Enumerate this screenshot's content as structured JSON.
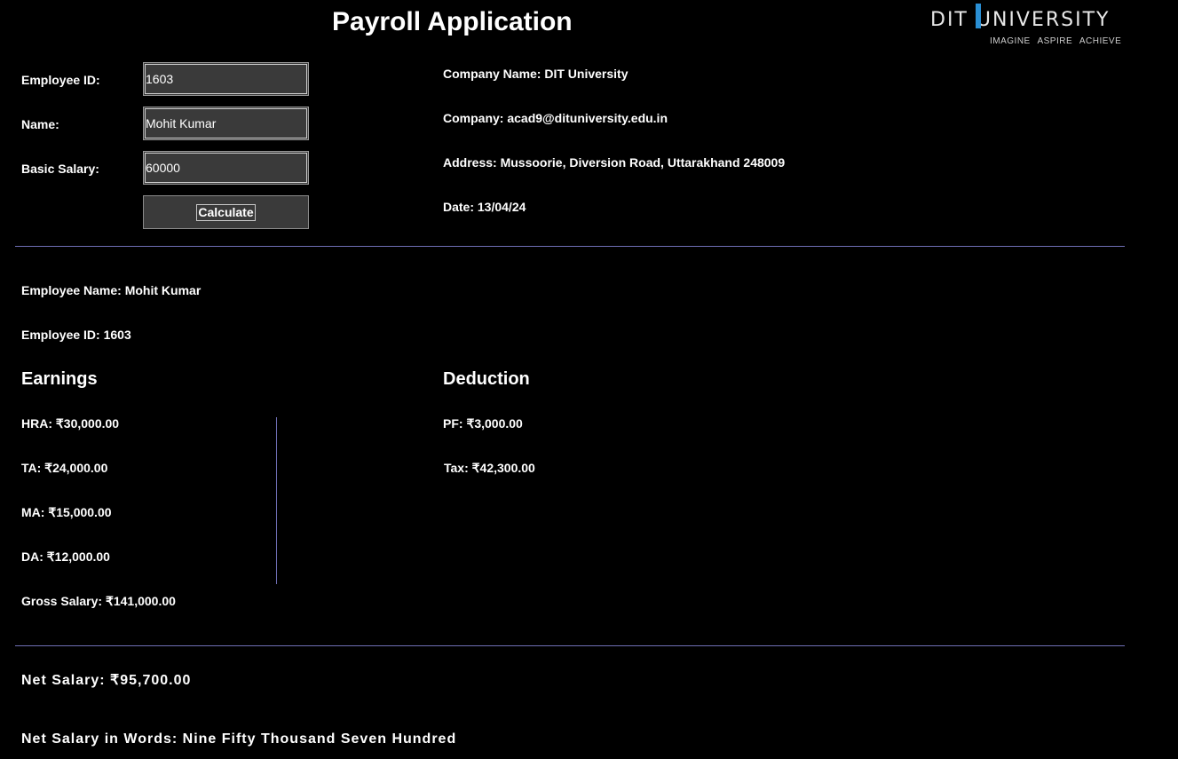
{
  "app": {
    "title": "Payroll Application"
  },
  "logo": {
    "name": "DIT UNIVERSITY",
    "tagline": "IMAGINE ASPIRE ACHIEVE",
    "accent_color": "#2a8fd4"
  },
  "form": {
    "employee_id_label": "Employee ID:",
    "employee_id_value": "1603",
    "name_label": "Name:",
    "name_value": "Mohit Kumar",
    "basic_salary_label": "Basic Salary:",
    "basic_salary_value": "60000",
    "calculate_label": "Calculate"
  },
  "company": {
    "name": "Company Name: DIT University",
    "email": "Company: acad9@dituniversity.edu.in",
    "address": "Address: Mussoorie, Diversion Road, Uttarakhand 248009",
    "date": "Date: 13/04/24"
  },
  "result": {
    "employee_name": "Employee Name:  Mohit Kumar",
    "employee_id": "Employee ID:  1603",
    "earnings_heading": "Earnings",
    "deduction_heading": "Deduction",
    "hra": "HRA: ₹30,000.00",
    "ta": "TA: ₹24,000.00",
    "ma": "MA: ₹15,000.00",
    "da": "DA: ₹12,000.00",
    "gross": "Gross Salary: ₹141,000.00",
    "pf": "PF: ₹3,000.00",
    "tax": "Tax: ₹42,300.00",
    "net_salary": "Net Salary: ₹95,700.00",
    "net_words": "Net Salary in Words: Nine Fifty Thousand Seven Hundred"
  },
  "colors": {
    "background": "#000000",
    "divider": "#6f6fb5",
    "field_bg": "#3a3a3a"
  }
}
